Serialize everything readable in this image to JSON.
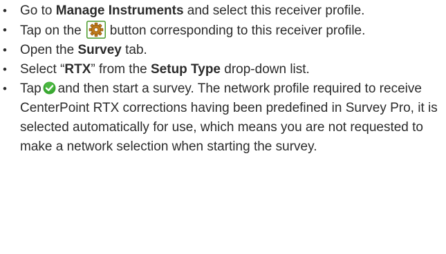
{
  "steps": [
    {
      "bullet": "•",
      "pre": "Go to ",
      "bold": "Manage Instruments",
      "post": " and select this receiver profile."
    },
    {
      "bullet": "•",
      "pre": "Tap on the",
      "icon": "settings-gear-icon",
      "post": "button corresponding to this receiver profile."
    },
    {
      "bullet": "•",
      "pre": "Open the ",
      "bold": "Survey",
      "post": " tab."
    },
    {
      "bullet": "•",
      "pre": "Select “",
      "bold": "RTX",
      "mid": "” from the ",
      "bold2": "Setup Type",
      "post": " drop-down list."
    },
    {
      "bullet": "•",
      "pre": "Tap",
      "icon": "green-check-icon",
      "post": "and then start a survey. The network profile required to receive CenterPoint RTX corrections having been predefined in Survey Pro, it is selected automatically for use, which means you are not requested to make a network selection when starting the survey."
    }
  ],
  "colors": {
    "text": "#2b2b2b",
    "gear_frame": "#4a9a2a",
    "gear_fill": "#c07a1a",
    "check_fill": "#3aa832"
  }
}
